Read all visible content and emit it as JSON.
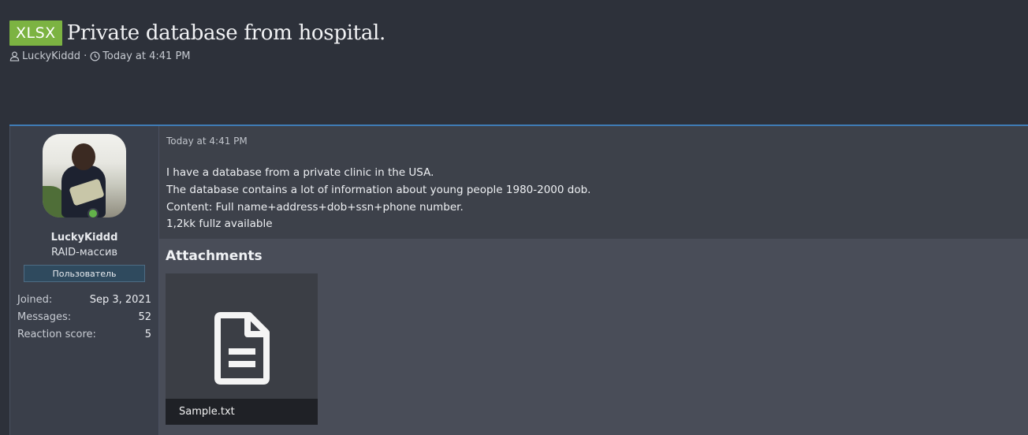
{
  "thread": {
    "prefix": "XLSX",
    "title": "Private database from hospital.",
    "author": "LuckyKiddd",
    "separator": "·",
    "date": "Today at 4:41 PM"
  },
  "post": {
    "date": "Today at 4:41 PM",
    "lines": [
      "I have a database from a private clinic in the USA.",
      "The database contains a lot of information about young people 1980-2000 dob.",
      "Content: Full name+address+dob+ssn+phone number.",
      "1,2kk fullz available"
    ]
  },
  "user": {
    "name": "LuckyKiddd",
    "title": "RAID-массив",
    "banner": "Пользователь",
    "online": true,
    "extras": [
      {
        "label": "Joined:",
        "value": "Sep 3, 2021"
      },
      {
        "label": "Messages:",
        "value": "52"
      },
      {
        "label": "Reaction score:",
        "value": "5"
      }
    ]
  },
  "attachments": {
    "heading": "Attachments",
    "items": [
      {
        "name": "Sample.txt",
        "icon": "document-icon"
      }
    ]
  },
  "icons": {
    "author": "user-icon",
    "date": "clock-icon"
  },
  "colors": {
    "prefix_bg": "#7cb342",
    "accent_border": "#3f7cb6",
    "online": "#63b34a"
  }
}
